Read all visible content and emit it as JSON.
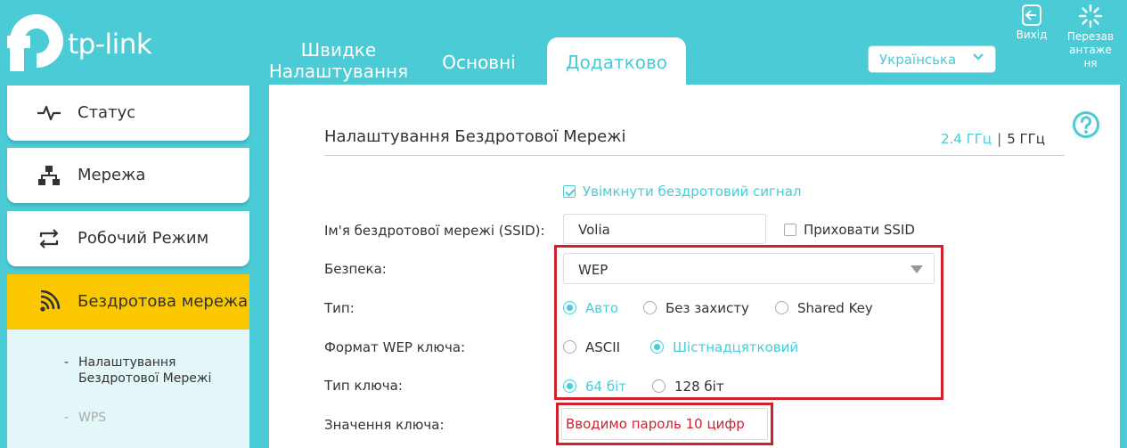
{
  "header": {
    "logo_text": "tp-link",
    "tabs": [
      {
        "label_line1": "Швидке",
        "label_line2": "Налаштування"
      },
      {
        "label": "Основні"
      },
      {
        "label": "Додатково"
      }
    ],
    "language": "Українська",
    "logout_label": "Вихід",
    "reboot_label_line1": "Перезав",
    "reboot_label_line2": "антаже",
    "reboot_label_line3": "ня"
  },
  "sidebar": {
    "items": [
      {
        "label": "Статус",
        "icon": "pulse-icon"
      },
      {
        "label": "Мережа",
        "icon": "network-icon"
      },
      {
        "label": "Робочий Режим",
        "icon": "mode-switch-icon"
      },
      {
        "label": "Бездротова мережа",
        "icon": "wireless-icon"
      }
    ],
    "submenu": [
      {
        "dash": "-",
        "label_line1": "Налаштування",
        "label_line2": "Бездротової Мережі"
      },
      {
        "dash": "-",
        "label": "WPS"
      }
    ]
  },
  "main": {
    "title": "Налаштування Бездротової Мережі",
    "band_24": "2.4 ГГц",
    "band_sep": "|",
    "band_5": "5 ГГц",
    "enable_wireless": "Увімкнути бездротовий сигнал",
    "ssid_label": "Ім'я бездротової мережі (SSID):",
    "ssid_value": "Volia",
    "hide_ssid": "Приховати SSID",
    "security_label": "Безпека:",
    "security_value": "WEP",
    "type_label": "Тип:",
    "type_options": [
      "Авто",
      "Без захисту",
      "Shared Key"
    ],
    "wep_format_label": "Формат WEP ключа:",
    "wep_format_options": [
      "ASCII",
      "Шістнадцятковий"
    ],
    "key_type_label": "Тип ключа:",
    "key_type_options": [
      "64 біт",
      "128 біт"
    ],
    "key_value_label": "Значення ключа:",
    "key_value": "Вводимо пароль 10 цифр"
  },
  "colors": {
    "accent": "#4acbd6",
    "active_menu": "#fbc800",
    "highlight_box": "#d0222d"
  }
}
